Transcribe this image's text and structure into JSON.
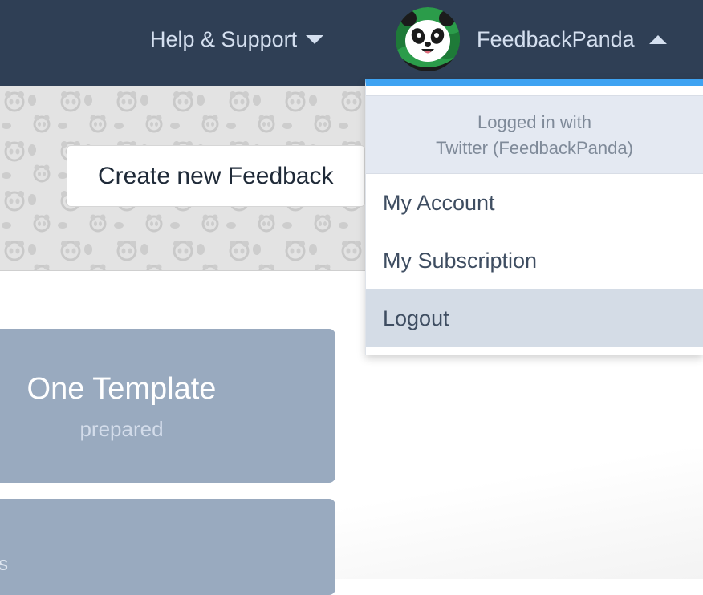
{
  "nav": {
    "help_label": "Help & Support",
    "user_name": "FeedbackPanda"
  },
  "hero": {
    "create_button_label": "Create new Feedback"
  },
  "user_dropdown": {
    "header_line1": "Logged in with",
    "header_line2": "Twitter (FeedbackPanda)",
    "items": [
      {
        "label": "My Account"
      },
      {
        "label": "My Subscription"
      },
      {
        "label": "Logout",
        "highlighted": true
      }
    ]
  },
  "cards": [
    {
      "title": "One Template",
      "subtitle": "prepared"
    },
    {
      "text": "rs"
    }
  ],
  "colors": {
    "nav_background": "#2f3f55",
    "dropdown_accent": "#3ea3f2",
    "card_background": "#99aabf",
    "highlight": "#d4dce6"
  },
  "icons": {
    "help_caret": "chevron-down-icon",
    "user_caret": "chevron-up-icon",
    "avatar": "panda-avatar"
  }
}
